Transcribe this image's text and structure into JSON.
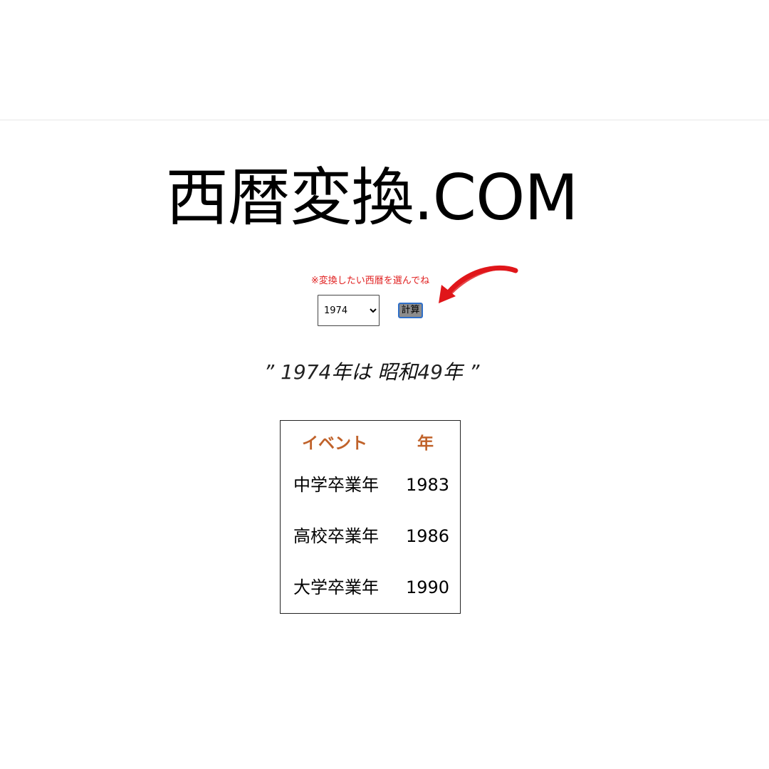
{
  "site": {
    "title": "西暦変換.COM"
  },
  "converter": {
    "hint": "※変換したい西暦を選んでね",
    "selected_year": "1974",
    "calc_label": "計算"
  },
  "result": {
    "open_quote": "”",
    "year": "1974",
    "year_suffix": "年は",
    "era_name": "昭和",
    "era_year": "49",
    "era_suffix": "年",
    "close_quote": "”"
  },
  "events_table": {
    "headers": [
      "イベント",
      "年"
    ],
    "rows": [
      {
        "event": "中学卒業年",
        "year": "1983"
      },
      {
        "event": "高校卒業年",
        "year": "1986"
      },
      {
        "event": "大学卒業年",
        "year": "1990"
      }
    ]
  },
  "colors": {
    "hint": "#e01e1e",
    "table_header": "#c0622a",
    "arrow": "#e0161a",
    "button_border": "#2f6fc8"
  },
  "icons": {
    "hint_arrow": "curved-arrow-icon"
  }
}
